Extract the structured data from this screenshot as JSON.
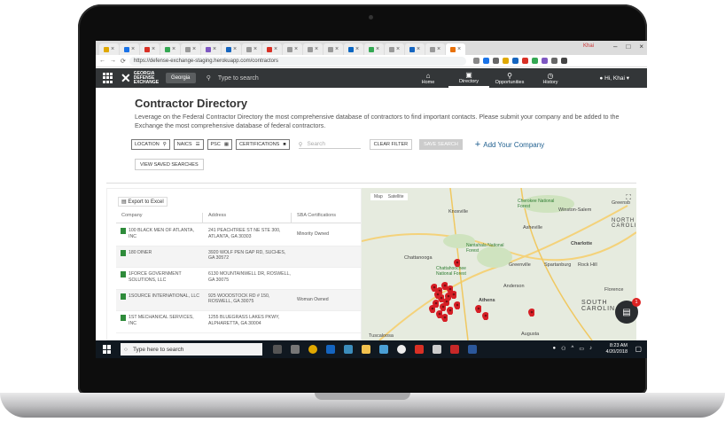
{
  "browser": {
    "tab_count_hint": "many",
    "url": "https://defense-exchange-staging.herokuapp.com/contractors",
    "window_user": "Khai"
  },
  "header": {
    "logo_text": "GEORGIA DEFENSE EXCHANGE",
    "partner_logo": "Georgia",
    "search_placeholder": "Type to search",
    "nav": [
      {
        "label": "Home",
        "icon": "home-icon"
      },
      {
        "label": "Directory",
        "icon": "directory-icon"
      },
      {
        "label": "Opportunities",
        "icon": "pin-icon"
      },
      {
        "label": "History",
        "icon": "clock-icon"
      }
    ],
    "user_greeting": "Hi, Khai"
  },
  "page": {
    "title": "Contractor Directory",
    "description": "Leverage on the Federal Contractor Directory the most comprehensive database of contractors to find important contacts. Please submit your company and be added to the Exchange the most comprehensive database of federal contractors."
  },
  "filters": {
    "location": "LOCATION",
    "naics": "NAICS",
    "psc": "PSC",
    "certifications": "CERTIFICATIONS",
    "search_placeholder": "Search",
    "clear": "CLEAR FILTER",
    "save": "SAVE SEARCH",
    "add_company": "Add Your Company",
    "view_saved": "VIEW SAVED SEARCHES"
  },
  "table": {
    "export_label": "Export to Excel",
    "headers": [
      "Company",
      "Address",
      "SBA Certifications"
    ],
    "rows": [
      {
        "company": "100 BLACK MEN OF ATLANTA, INC",
        "address": "241 PEACHTREE ST NE STE 300, ATLANTA, GA 30303",
        "cert": "Minority Owned"
      },
      {
        "company": "180 DINER",
        "address": "3920 WOLF PEN GAP RD, SUCHES, GA 30572",
        "cert": ""
      },
      {
        "company": "1FORCE GOVERNMENT SOLUTIONS, LLC",
        "address": "6130 MOUNTAINWELL DR, ROSWELL, GA 30075",
        "cert": ""
      },
      {
        "company": "1SOURCE INTERNATIONAL, LLC",
        "address": "925 WOODSTOCK RD # 150, ROSWELL, GA 30075",
        "cert": "Woman Owned"
      },
      {
        "company": "1ST MECHANICAL SERVICES, INC",
        "address": "1255 BLUEGRASS LAKES PKWY, ALPHARETTA, GA 30004",
        "cert": ""
      }
    ]
  },
  "map": {
    "tabs": [
      "Map",
      "Satellite"
    ],
    "labels": [
      "Knoxville",
      "Cherokee National Forest",
      "Winston-Salem",
      "Greensb",
      "Asheville",
      "Charlotte",
      "Nantahala National Forest",
      "Chattanooga",
      "Chattahoochee National Forest",
      "Greenville",
      "Spartanburg",
      "Rock Hill",
      "Anderson",
      "Athens",
      "SOUTH CAROLINA",
      "Augusta",
      "Florence",
      "Tuscaloosa",
      "NORTH CAROLINA"
    ]
  },
  "chat": {
    "badge": "1"
  },
  "taskbar": {
    "search_placeholder": "Type here to search",
    "time": "8:23 AM",
    "date": "4/20/2018"
  },
  "colors": {
    "header_bg": "#333638",
    "accent_blue": "#1f5f8f",
    "pin_red": "#d61f26",
    "doc_green": "#2e8b3a"
  }
}
